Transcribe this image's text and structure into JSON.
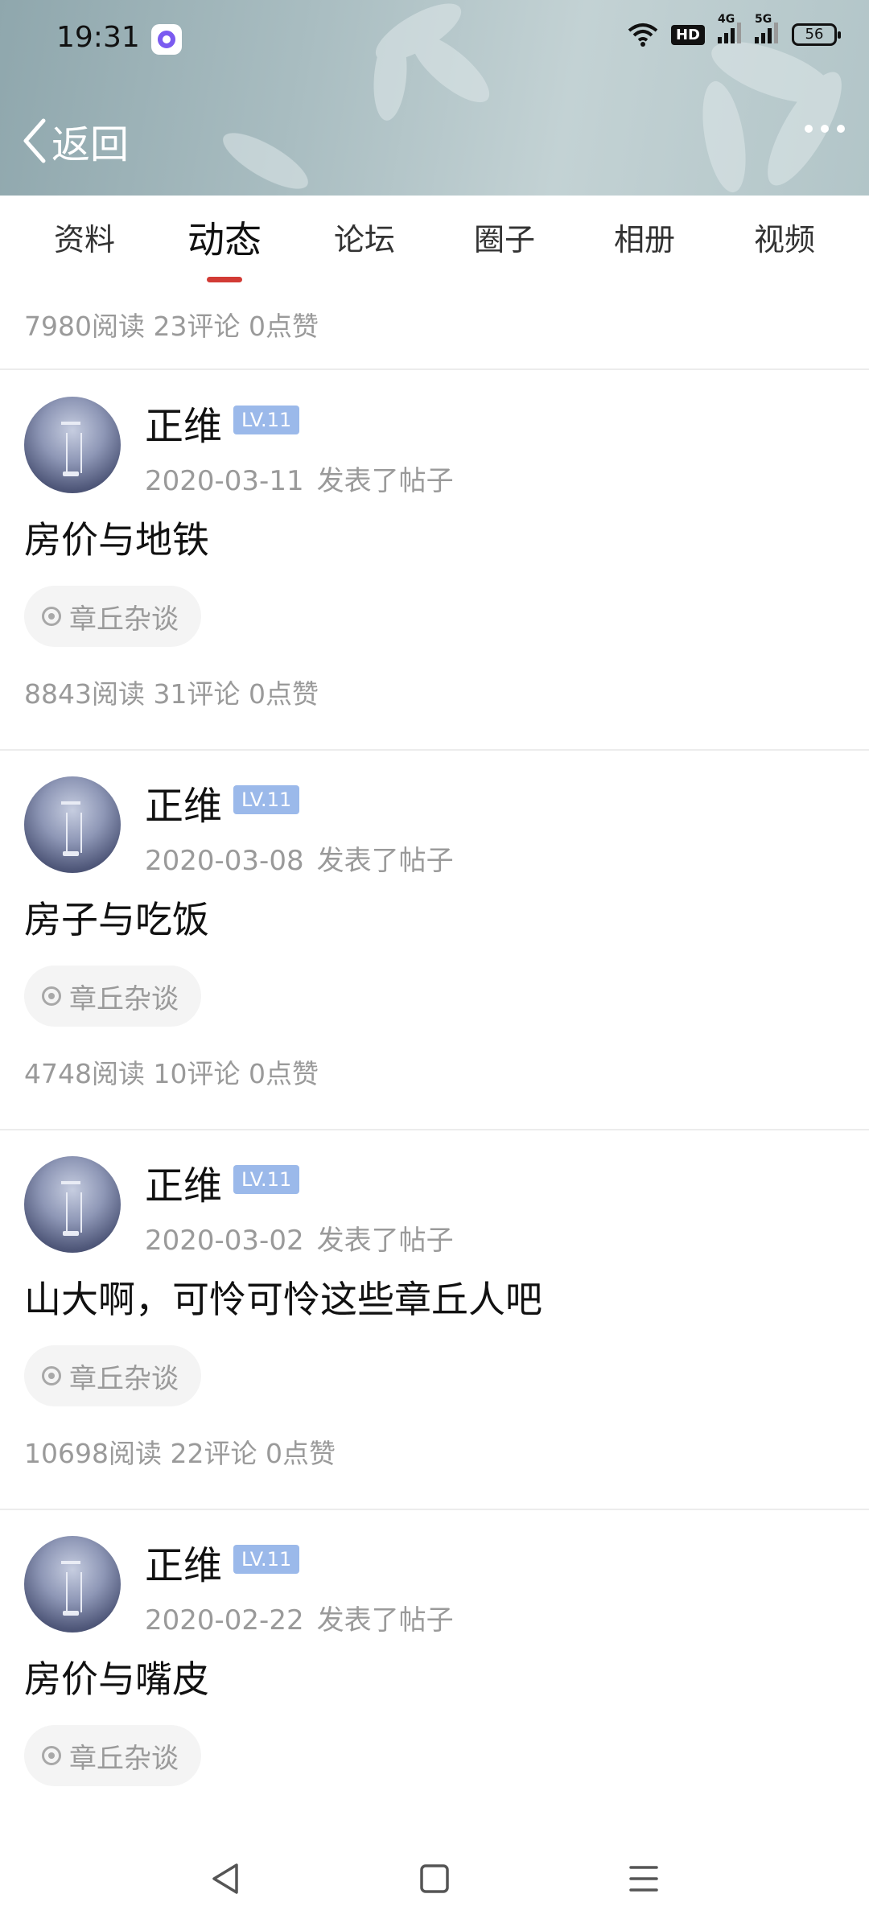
{
  "status_bar": {
    "time": "19:31",
    "hd_label": "HD",
    "net1": "4G",
    "net2": "5G",
    "battery": "56"
  },
  "header": {
    "back_label": "返回"
  },
  "tabs": [
    {
      "label": "资料"
    },
    {
      "label": "动态"
    },
    {
      "label": "论坛"
    },
    {
      "label": "圈子"
    },
    {
      "label": "相册"
    },
    {
      "label": "视频"
    }
  ],
  "active_tab": "动态",
  "top_stats": "7980阅读 23评论 0点赞",
  "posts": [
    {
      "author": "正维",
      "level": "LV.11",
      "date": "2020-03-11",
      "action": "发表了帖子",
      "title": "房价与地铁",
      "tag": "章丘杂谈",
      "stats": "8843阅读 31评论 0点赞"
    },
    {
      "author": "正维",
      "level": "LV.11",
      "date": "2020-03-08",
      "action": "发表了帖子",
      "title": "房子与吃饭",
      "tag": "章丘杂谈",
      "stats": "4748阅读 10评论 0点赞"
    },
    {
      "author": "正维",
      "level": "LV.11",
      "date": "2020-03-02",
      "action": "发表了帖子",
      "title": "山大啊，可怜可怜这些章丘人吧",
      "tag": "章丘杂谈",
      "stats": "10698阅读 22评论 0点赞"
    },
    {
      "author": "正维",
      "level": "LV.11",
      "date": "2020-02-22",
      "action": "发表了帖子",
      "title": "房价与嘴皮",
      "tag": "章丘杂谈",
      "stats": ""
    }
  ],
  "colors": {
    "accent": "#d23b35",
    "level_badge": "#9bb9ea",
    "muted_text": "#9a9a9a"
  }
}
